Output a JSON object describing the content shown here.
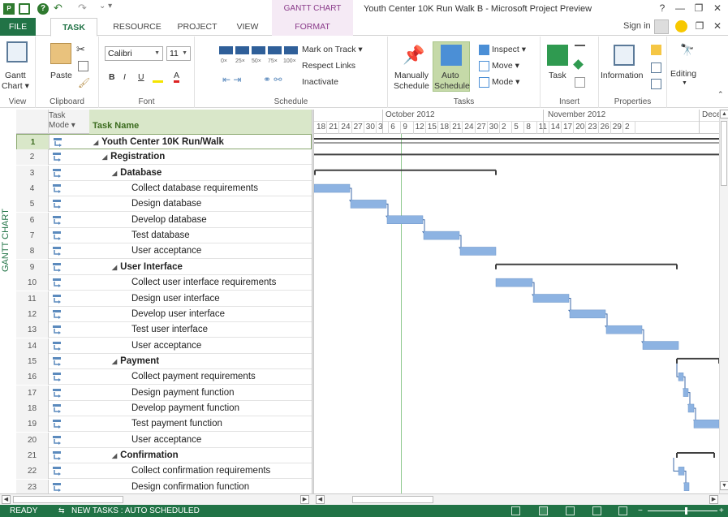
{
  "titlebar": {
    "undo": "↶",
    "redo": "↷",
    "customize": "⌄ ▾",
    "context_tab": "GANTT CHART TOOLS",
    "title": "Youth Center 10K Run Walk B - Microsoft Project Preview",
    "help": "?",
    "minimize": "—",
    "restore": "❐",
    "close": "✕",
    "app_icon_text": "P"
  },
  "tabs": {
    "file": "FILE",
    "task": "TASK",
    "resource": "RESOURCE",
    "project": "PROJECT",
    "view": "VIEW",
    "format": "FORMAT",
    "signin": "Sign in",
    "ribbon_restore": "❐",
    "ribbon_close": "✕"
  },
  "ribbon": {
    "view": {
      "label": "View",
      "button": "Gantt",
      "button2": "Chart ▾"
    },
    "clipboard": {
      "label": "Clipboard",
      "paste": "Paste"
    },
    "font": {
      "label": "Font",
      "family": "Calibri",
      "size": "11",
      "bold": "B",
      "italic": "I",
      "underline": "U",
      "color_a": "A"
    },
    "schedule": {
      "label": "Schedule",
      "pct": [
        "0×",
        "25×",
        "50×",
        "75×",
        "100×"
      ],
      "mark_on_track": "Mark on Track ▾",
      "respect_links": "Respect Links",
      "inactivate": "Inactivate"
    },
    "tasks": {
      "label": "Tasks",
      "manually_1": "Manually",
      "manually_2": "Schedule",
      "auto_1": "Auto",
      "auto_2": "Schedule",
      "inspect": "Inspect ▾",
      "move": "Move ▾",
      "mode": "Mode ▾"
    },
    "insert": {
      "label": "Insert",
      "task": "Task"
    },
    "properties": {
      "label": "Properties",
      "information": "Information"
    },
    "editing": {
      "label": "",
      "editing": "Editing"
    }
  },
  "view_tab": "GANTT CHART",
  "grid": {
    "header_mode_1": "Task",
    "header_mode_2": "Mode ▾",
    "header_name": "Task Name",
    "rows": [
      {
        "id": "1",
        "name": "Youth Center 10K Run/Walk",
        "level": 0
      },
      {
        "id": "2",
        "name": "Registration",
        "level": 1
      },
      {
        "id": "3",
        "name": "Database",
        "level": 2
      },
      {
        "id": "4",
        "name": "Collect database requirements",
        "level": 3
      },
      {
        "id": "5",
        "name": "Design database",
        "level": 3
      },
      {
        "id": "6",
        "name": "Develop database",
        "level": 3
      },
      {
        "id": "7",
        "name": "Test database",
        "level": 3
      },
      {
        "id": "8",
        "name": "User acceptance",
        "level": 3
      },
      {
        "id": "9",
        "name": "User Interface",
        "level": 2
      },
      {
        "id": "10",
        "name": "Collect user interface requirements",
        "level": 3
      },
      {
        "id": "11",
        "name": "Design user interface",
        "level": 3
      },
      {
        "id": "12",
        "name": "Develop user interface",
        "level": 3
      },
      {
        "id": "13",
        "name": "Test user interface",
        "level": 3
      },
      {
        "id": "14",
        "name": "User acceptance",
        "level": 3
      },
      {
        "id": "15",
        "name": "Payment",
        "level": 2
      },
      {
        "id": "16",
        "name": "Collect payment requirements",
        "level": 3
      },
      {
        "id": "17",
        "name": "Design payment function",
        "level": 3
      },
      {
        "id": "18",
        "name": "Develop payment function",
        "level": 3
      },
      {
        "id": "19",
        "name": "Test payment function",
        "level": 3
      },
      {
        "id": "20",
        "name": "User acceptance",
        "level": 3
      },
      {
        "id": "21",
        "name": "Confirmation",
        "level": 2
      },
      {
        "id": "22",
        "name": "Collect confirmation requirements",
        "level": 3
      },
      {
        "id": "23",
        "name": "Design confirmation function",
        "level": 3
      }
    ]
  },
  "timeline": {
    "months": [
      {
        "label": "October 2012"
      },
      {
        "label": "November 2012"
      },
      {
        "label": "Dece"
      }
    ],
    "days": [
      "18",
      "21",
      "24",
      "27",
      "30",
      "3",
      "6",
      "9",
      "12",
      "15",
      "18",
      "21",
      "24",
      "27",
      "30",
      "2",
      "5",
      "8",
      "11",
      "14",
      "17",
      "20",
      "23",
      "26",
      "29",
      "2"
    ]
  },
  "status": {
    "ready": "READY",
    "new_tasks": "NEW TASKS : AUTO SCHEDULED"
  },
  "colors": {
    "accent": "#217346",
    "task_bar": "#8db3e2",
    "summary_bar": "#404040",
    "context": "#8a3b8a"
  }
}
